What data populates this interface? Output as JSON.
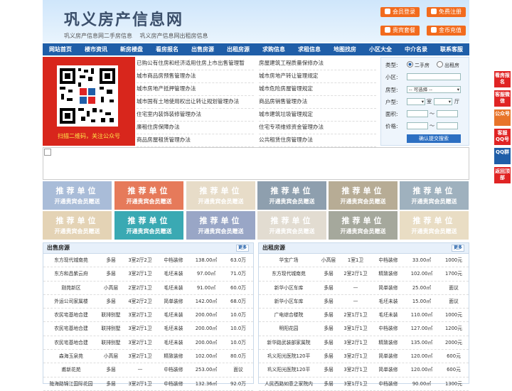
{
  "header": {
    "logo": "巩义房产信息网",
    "sub_links": [
      "巩义房产信息网二手房信息",
      "巩义房产信息网出租房信息"
    ],
    "buttons": [
      "会员登录",
      "免费注册",
      "贵宾套餐",
      "金币充值"
    ]
  },
  "nav": [
    "网站首页",
    "楼市资讯",
    "新房楼盘",
    "看房报名",
    "出售房源",
    "出租房源",
    "求购信息",
    "求租信息",
    "地图找房",
    "小区大全",
    "中介名录",
    "联系客服"
  ],
  "qr": {
    "caption": "扫描二维码，关注公众号"
  },
  "links": {
    "left": [
      "已购公有住房和经济适用住房上市出售管理暂",
      "城市商品房预售管理办法",
      "城市房地产抵押管理办法",
      "城市国有土地使用权出让转让规划管理办法",
      "住宅室内装饰装修管理办法",
      "廉租住房保障办法",
      "商品房屋租赁管理办法"
    ],
    "right": [
      "房屋建筑工程质量保修办法",
      "城市房地产转让管理规定",
      "城市危险房屋管理规定",
      "商品房销售管理办法",
      "城市建筑垃圾管理规定",
      "住宅专项维修资金管理办法",
      "公共租赁住房管理办法"
    ]
  },
  "search": {
    "type_label": "类型:",
    "opt_sale": "二手房",
    "opt_rent": "出租房",
    "community_label": "小区:",
    "layout_label": "房型:",
    "layout_value": "-- 可选择 --",
    "rooms_label": "户型:",
    "room_unit": "室",
    "hall_unit": "厅",
    "area_label": "面积:",
    "price_label": "价格:",
    "tilde": "～",
    "submit": "确认提交搜索"
  },
  "ads": {
    "line1": "推荐单位",
    "line2": "开通贵宾会员赠送",
    "colors": [
      "#a9bcd8",
      "#e67a5a",
      "#e7dcc8",
      "#8e9fae",
      "#b7ac95",
      "#9fb1be",
      "#e4d3b5",
      "#3aa9b3",
      "#99a6c6",
      "#e2dcd1",
      "#a5a89c",
      "#e9ddc4"
    ]
  },
  "sale": {
    "title": "出售房源",
    "more": "更多",
    "rows": [
      [
        "东方现代城南苑",
        "多层",
        "3室2厅2卫",
        "中档装修",
        "138.00㎡",
        "63.0万"
      ],
      [
        "东方和昌紫云府",
        "多层",
        "3室2厅1卫",
        "毛坯未装",
        "97.00㎡",
        "71.0万"
      ],
      [
        "刚苑新区",
        "小高层",
        "2室2厅1卫",
        "毛坯未装",
        "91.00㎡",
        "60.0万"
      ],
      [
        "外运公司家属楼",
        "多层",
        "4室2厅2卫",
        "简单装修",
        "142.00㎡",
        "68.0万"
      ],
      [
        "农民宅基地合建",
        "联排别墅",
        "3室2厅1卫",
        "毛坯未装",
        "200.00㎡",
        "10.0万"
      ],
      [
        "农民宅基地合建",
        "联排别墅",
        "3室2厅1卫",
        "毛坯未装",
        "200.00㎡",
        "10.0万"
      ],
      [
        "农民宅基地合建",
        "联排别墅",
        "3室2厅1卫",
        "毛坯未装",
        "200.00㎡",
        "10.0万"
      ],
      [
        "森海玉泉苑",
        "小高层",
        "3室2厅1卫",
        "精致装修",
        "102.00㎡",
        "80.0万"
      ],
      [
        "甫新花苑",
        "多层",
        "—",
        "中档装修",
        "253.00㎡",
        "面议"
      ],
      [
        "陇海路锦江国际花园",
        "多层",
        "3室2厅1卫",
        "中档装修",
        "132.36㎡",
        "92.0万"
      ]
    ]
  },
  "rent": {
    "title": "出租房源",
    "more": "更多",
    "rows": [
      [
        "华宝广场",
        "小高层",
        "1室1卫",
        "中档装修",
        "33.00㎡",
        "1000元"
      ],
      [
        "东方现代城南苑",
        "多层",
        "2室2厅1卫",
        "精致装修",
        "102.00㎡",
        "1700元"
      ],
      [
        "新华小区车库",
        "多层",
        "—",
        "简单装修",
        "25.00㎡",
        "面议"
      ],
      [
        "新华小区车库",
        "多层",
        "—",
        "毛坯未装",
        "15.00㎡",
        "面议"
      ],
      [
        "广电综合楼院",
        "多层",
        "2室1厅1卫",
        "毛坯未装",
        "110.00㎡",
        "1000元"
      ],
      [
        "明阳花园",
        "多层",
        "3室1厅1卫",
        "中档装修",
        "127.00㎡",
        "1200元"
      ],
      [
        "新华路武装部家属院",
        "多层",
        "3室2厅1卫",
        "精致装修",
        "135.00㎡",
        "2000元"
      ],
      [
        "巩义阳光医院120平",
        "多层",
        "3室2厅1卫",
        "简单装修",
        "120.00㎡",
        "600元"
      ],
      [
        "巩义阳光医院120平",
        "多层",
        "3室2厅1卫",
        "简单装修",
        "120.00㎡",
        "600元"
      ],
      [
        "人民西路如意之家院内",
        "多层",
        "3室1厅1卫",
        "中档装修",
        "90.00㎡",
        "1300元"
      ]
    ]
  },
  "side": [
    "看房报名",
    "客服微信",
    "公众号",
    "客服QQ号",
    "QQ群",
    "返回顶部"
  ]
}
